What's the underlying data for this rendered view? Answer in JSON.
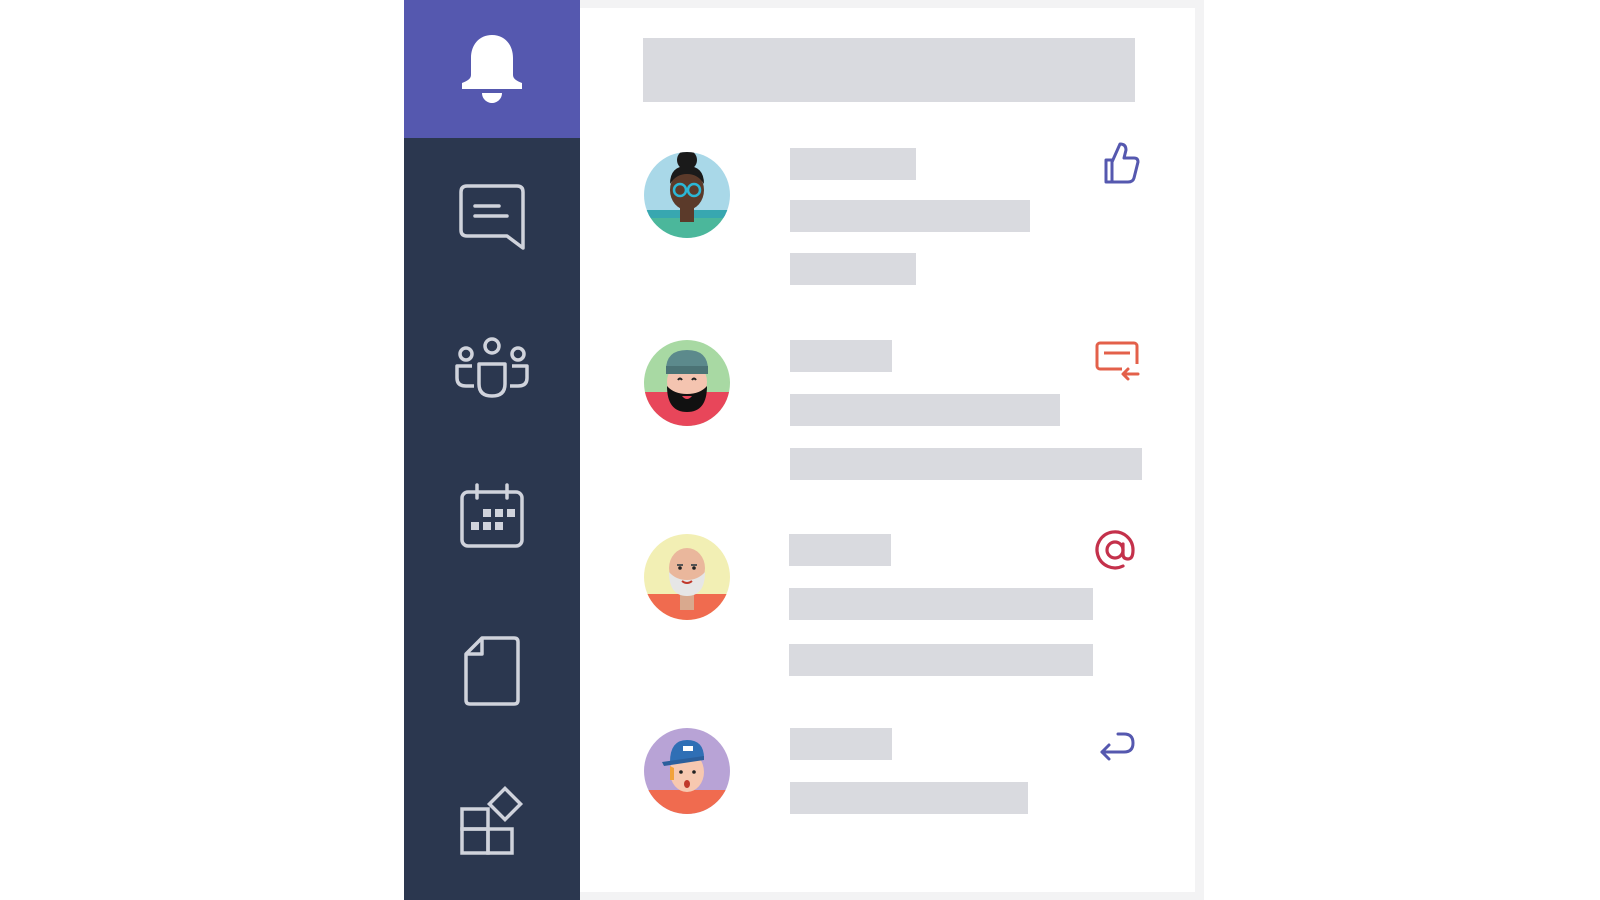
{
  "nav": {
    "items": [
      {
        "id": "activity",
        "icon": "bell-icon",
        "active": true
      },
      {
        "id": "chat",
        "icon": "chat-icon",
        "active": false
      },
      {
        "id": "teams",
        "icon": "teams-icon",
        "active": false
      },
      {
        "id": "calendar",
        "icon": "calendar-icon",
        "active": false
      },
      {
        "id": "files",
        "icon": "file-icon",
        "active": false
      },
      {
        "id": "apps",
        "icon": "apps-icon",
        "active": false
      }
    ]
  },
  "feed": {
    "items": [
      {
        "avatar": "avatar-woman-sunglasses",
        "activity_icon": "thumbs-up-icon",
        "activity_color": "#5558af"
      },
      {
        "avatar": "avatar-bearded-man-beanie",
        "activity_icon": "reply-card-icon",
        "activity_color": "#e3604a"
      },
      {
        "avatar": "avatar-older-man-beard",
        "activity_icon": "at-mention-icon",
        "activity_color": "#c4314b"
      },
      {
        "avatar": "avatar-man-cap",
        "activity_icon": "reply-arrow-icon",
        "activity_color": "#5558af"
      }
    ]
  },
  "colors": {
    "accent": "#5558af",
    "rail": "#2b374f",
    "placeholder": "#d9dadf"
  }
}
